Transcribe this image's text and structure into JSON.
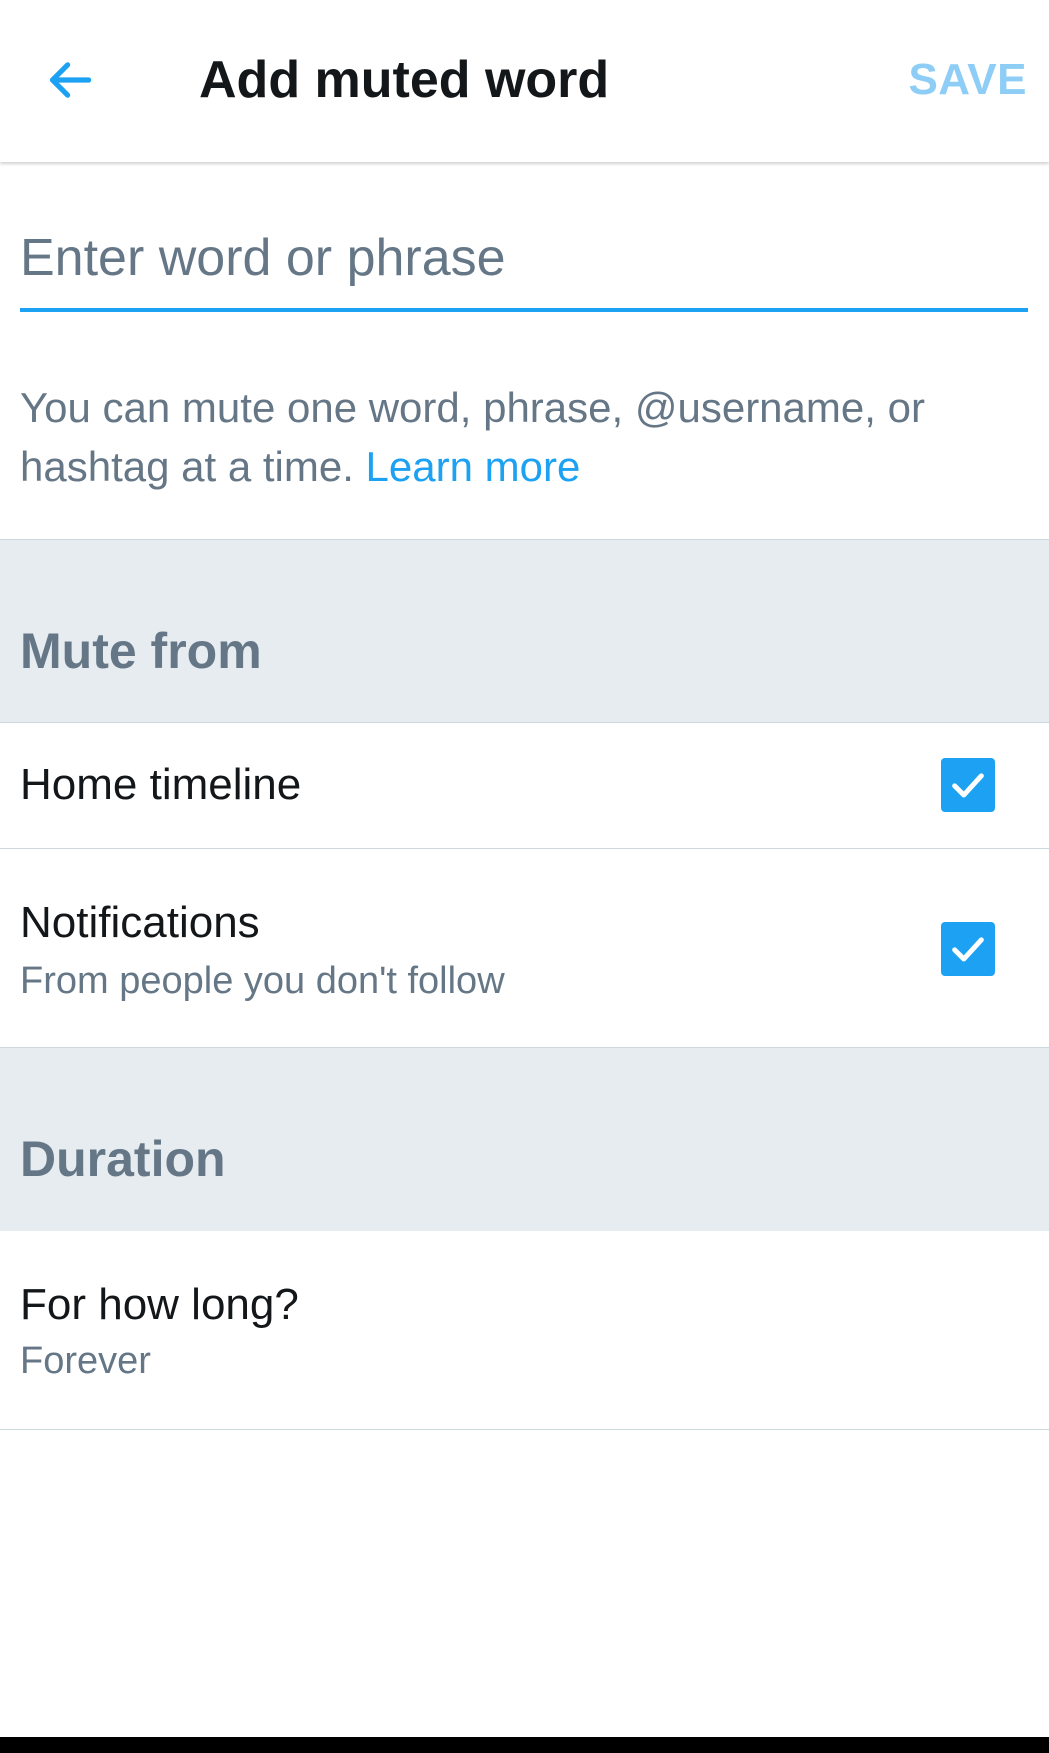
{
  "header": {
    "back_icon": "arrow-left-icon",
    "title": "Add muted word",
    "save_label": "SAVE"
  },
  "input": {
    "value": "",
    "placeholder": "Enter word or phrase"
  },
  "help": {
    "text": "You can mute one word, phrase, @username, or hashtag at a time.",
    "link_label": "Learn more"
  },
  "mute_from": {
    "section_label": "Mute from",
    "home_timeline": {
      "title": "Home timeline",
      "checked": true
    },
    "notifications": {
      "title": "Notifications",
      "subtitle": "From people you don't follow",
      "checked": true
    }
  },
  "duration": {
    "section_label": "Duration",
    "for_how_long": {
      "title": "For how long?",
      "value": "Forever"
    }
  },
  "colors": {
    "accent": "#1da1f2",
    "save_disabled": "#8ecdf5",
    "section_bg": "#e6ecf0",
    "secondary_text": "#657786",
    "primary_text": "#14171a"
  }
}
